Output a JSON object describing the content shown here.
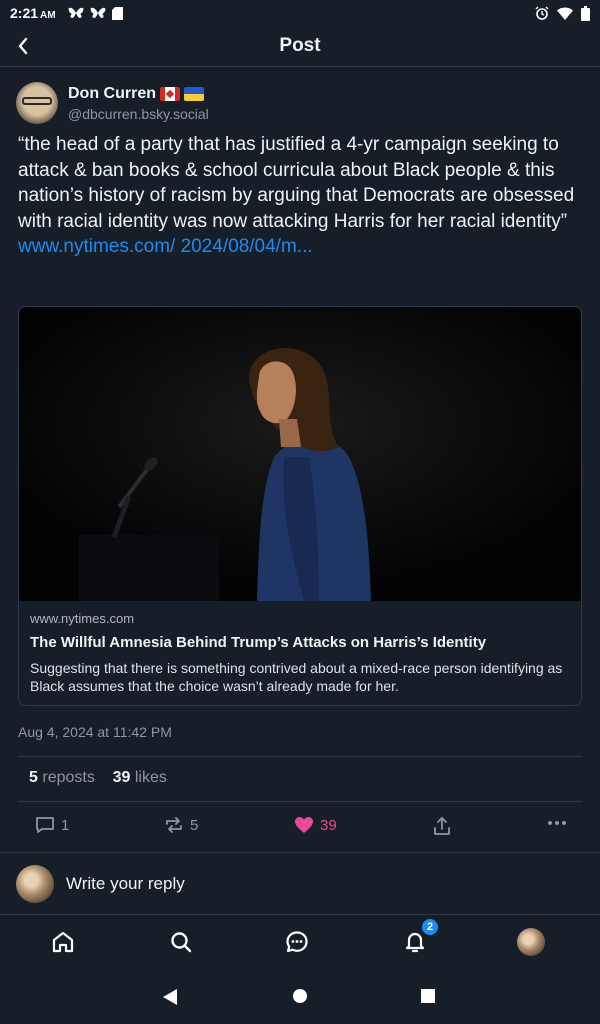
{
  "status_bar": {
    "time": "2:21",
    "ampm": "AM",
    "left_icons": [
      "butterfly-icon",
      "butterfly-icon",
      "sd-card-icon"
    ],
    "right_icons": [
      "alarm-icon",
      "wifi-icon",
      "battery-icon"
    ]
  },
  "header": {
    "title": "Post",
    "back_icon": "chevron-left-icon"
  },
  "author": {
    "display_name": "Don Curren",
    "flags": [
      "canada-flag-icon",
      "ukraine-flag-icon"
    ],
    "handle": "@dbcurren.bsky.social"
  },
  "post": {
    "text": "“the head of a party that has justified a 4-yr campaign seeking to attack & ban books & school curricula about Black people & this nation’s history of racism by arguing that Democrats are obsessed with racial identity was now attacking Harris for her racial identity” ",
    "link_text": "www.nytimes.com/ 2024/08/04/m..."
  },
  "link_card": {
    "domain": "www.nytimes.com",
    "title": "The Willful Amnesia Behind Trump’s Attacks on Harris’s Identity",
    "description": "Suggesting that there is something contrived about a mixed-race person identifying as Black assumes that the choice wasn’t already made for her."
  },
  "timestamp": "Aug 4, 2024 at 11:42 PM",
  "stats": {
    "reposts_count": "5",
    "reposts_label": "reposts",
    "likes_count": "39",
    "likes_label": "likes"
  },
  "actions": {
    "reply_count": "1",
    "repost_count": "5",
    "like_count": "39",
    "like_color": "#ec4899"
  },
  "reply": {
    "placeholder": "Write your reply"
  },
  "tabbar": {
    "items": [
      "home-icon",
      "search-icon",
      "chat-icon",
      "bell-icon",
      "profile-avatar"
    ],
    "notification_badge": "2"
  },
  "colors": {
    "background": "#161e27",
    "link": "#1d8cf0",
    "muted": "#8b98a5",
    "divider": "#2e3a47",
    "badge": "#1d8cf0"
  }
}
